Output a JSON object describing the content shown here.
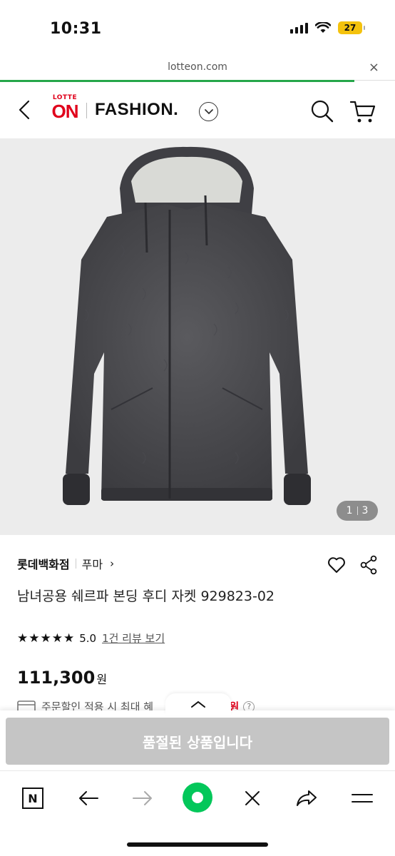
{
  "status_bar": {
    "time": "10:31",
    "battery": "27"
  },
  "browser": {
    "url": "lotteon.com",
    "close_glyph": "×"
  },
  "header": {
    "logo_top": "LOTTE",
    "logo_main": "ON",
    "section": "FASHION."
  },
  "gallery": {
    "current": "1",
    "total": "3"
  },
  "product": {
    "store": "롯데백화점",
    "brand": "푸마",
    "brand_arrow": "›",
    "title": "남녀공용 쉐르파 본딩 후디 자켓 929823-02",
    "stars": "★★★★★",
    "rating": "5.0",
    "review_link": "1건 리뷰 보기",
    "price": "111,300",
    "price_unit": "원",
    "discount_text": "주문할인 적용 시 최대 혜",
    "discount_amount": "0원",
    "help": "?"
  },
  "bottom_sheet": {
    "soldout_label": "품절된 상품입니다"
  },
  "toolbar": {
    "naver_label": "N"
  },
  "colors": {
    "brand_red": "#e0001b",
    "progress_green": "#25a64a",
    "naver_green": "#03c75a",
    "soldout_gray": "#c5c5c5"
  },
  "icons": [
    "back-icon",
    "chevron-down-icon",
    "search-icon",
    "cart-icon",
    "heart-icon",
    "share-icon",
    "card-icon",
    "chevron-up-icon",
    "naver-n-icon",
    "arrow-left-icon",
    "arrow-right-icon",
    "close-icon",
    "forward-share-icon",
    "menu-icon"
  ]
}
